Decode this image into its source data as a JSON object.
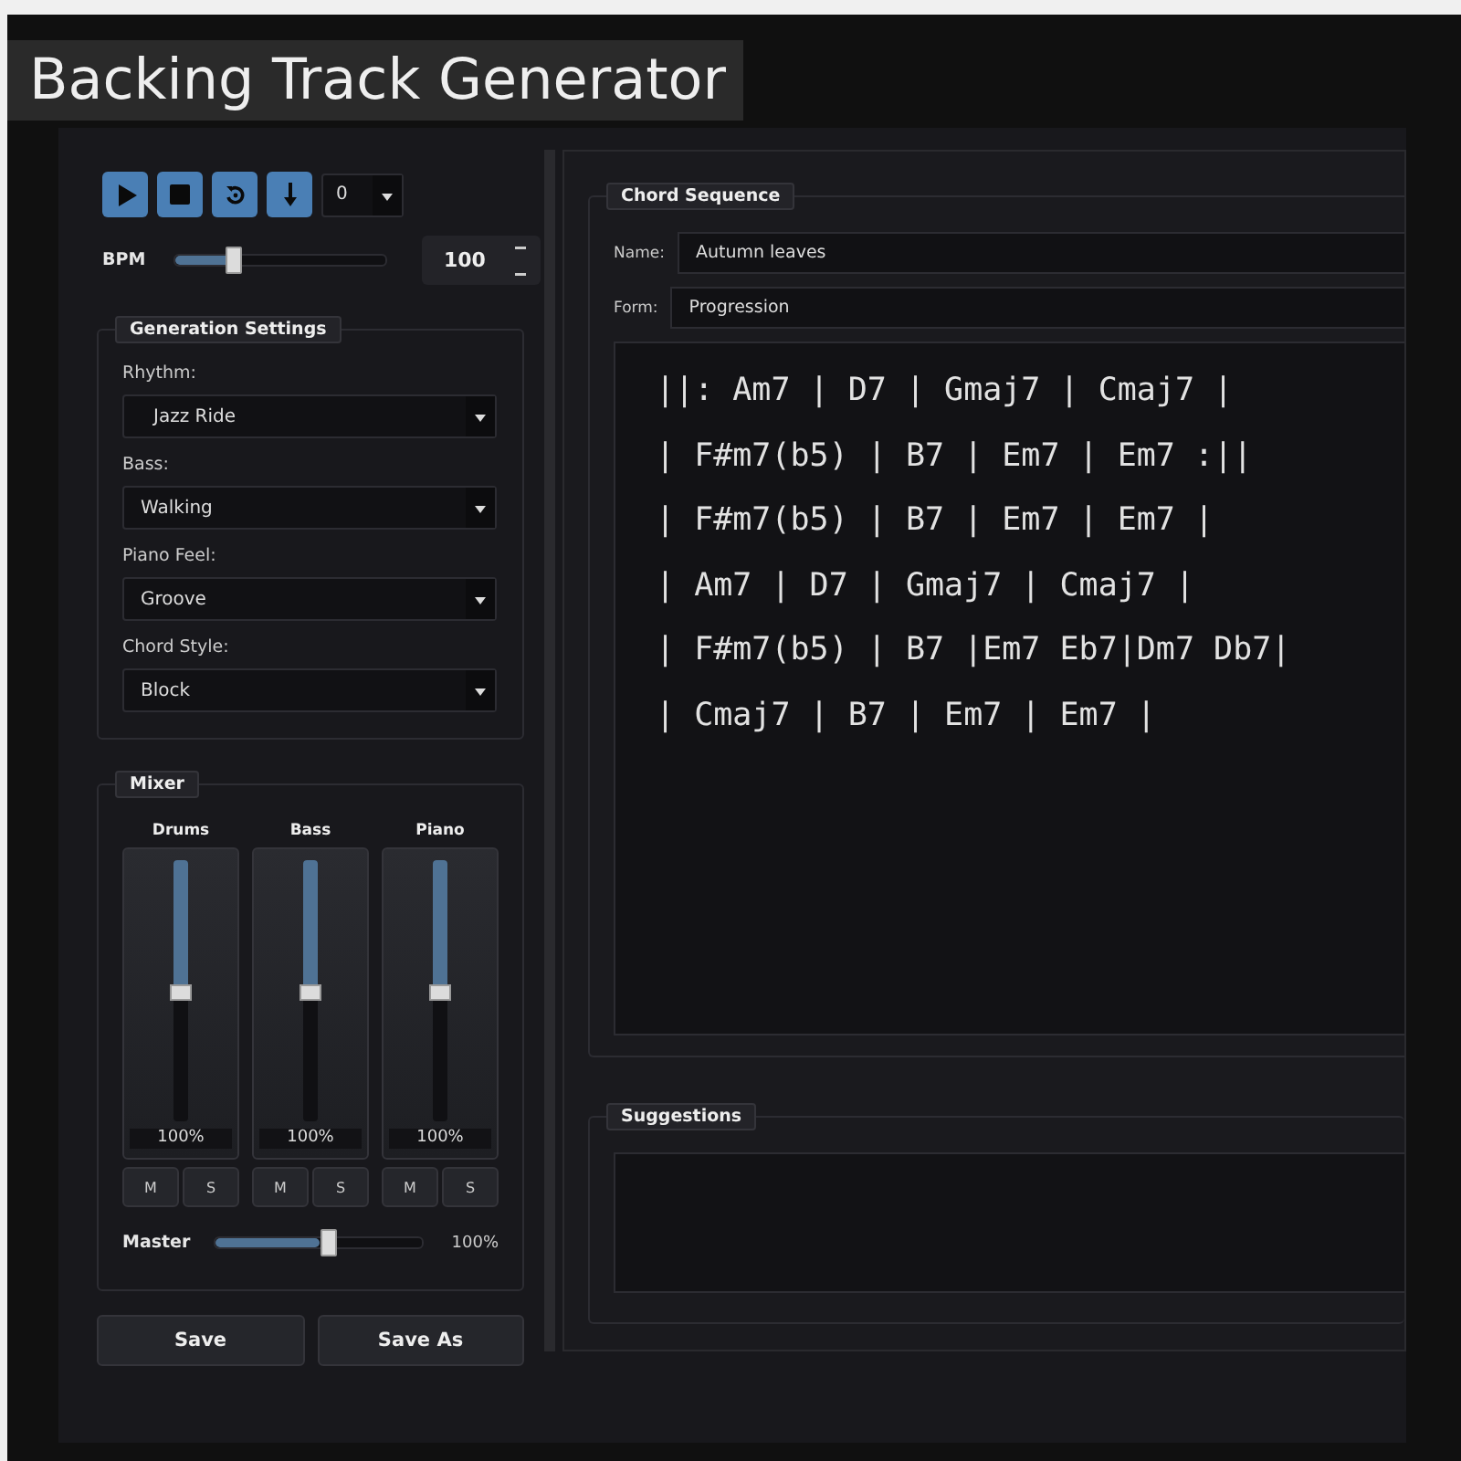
{
  "title": "Backing Track Generator",
  "transport": {
    "buttons": [
      {
        "kind": "play"
      },
      {
        "kind": "stop"
      },
      {
        "kind": "loop"
      },
      {
        "kind": "download"
      }
    ],
    "count": "0"
  },
  "bpm": {
    "label": "BPM",
    "level": 0.26,
    "value": "100"
  },
  "generation_settings": {
    "title": "Generation Settings",
    "fields": [
      {
        "label": "Rhythm:",
        "value": "Jazz Ride"
      },
      {
        "label": "Bass:",
        "value": "Walking"
      },
      {
        "label": "Piano Feel:",
        "value": "Groove"
      },
      {
        "label": "Chord Style:",
        "value": "Block"
      }
    ]
  },
  "mixer": {
    "title": "Mixer",
    "channels": [
      {
        "name": "Drums",
        "level": 0.5,
        "reading": "100%",
        "mute": "M",
        "solo": "S"
      },
      {
        "name": "Bass",
        "level": 0.5,
        "reading": "100%",
        "mute": "M",
        "solo": "S"
      },
      {
        "name": "Piano",
        "level": 0.5,
        "reading": "100%",
        "mute": "M",
        "solo": "S"
      }
    ],
    "master": {
      "label": "Master",
      "level": 0.5,
      "reading": "100%"
    }
  },
  "buttons": [
    "Save",
    "Save As"
  ],
  "chord_sequence": {
    "title": "Chord Sequence",
    "name_label": "Name:",
    "name": "Autumn leaves",
    "form_label": "Form:",
    "form": "Progression",
    "lines": [
      "||: Am7 | D7 | Gmaj7 | Cmaj7 |",
      "| F#m7(b5) | B7 | Em7 | Em7 :||",
      "| F#m7(b5) | B7 | Em7 | Em7 |",
      "| Am7 | D7 | Gmaj7 | Cmaj7 |",
      "| F#m7(b5) | B7 |Em7 Eb7|Dm7 Db7|",
      "| Cmaj7 | B7 | Em7 | Em7 |"
    ]
  },
  "suggestions": {
    "title": "Suggestions"
  }
}
